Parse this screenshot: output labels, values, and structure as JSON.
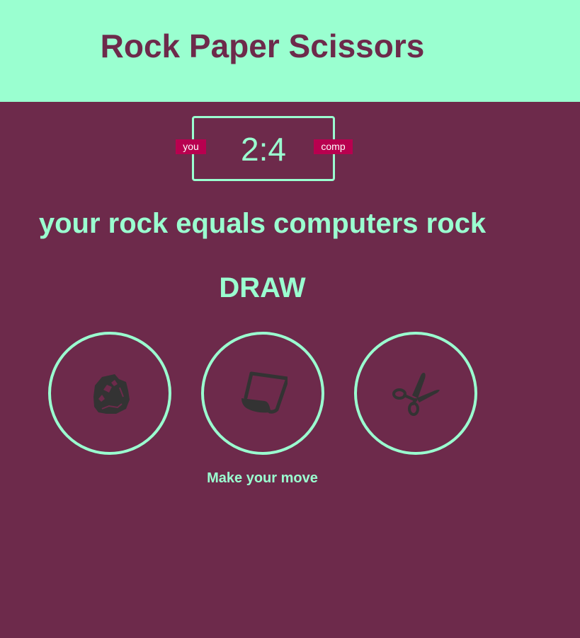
{
  "header": {
    "title": "Rock Paper Scissors"
  },
  "scoreboard": {
    "user_label": "you",
    "comp_label": "comp",
    "user_score": 2,
    "comp_score": 4,
    "score_text": "2:4"
  },
  "result": {
    "message": "your rock equals computers rock",
    "outcome": "DRAW"
  },
  "choices": [
    {
      "id": "rock",
      "icon": "rock-icon"
    },
    {
      "id": "paper",
      "icon": "paper-icon"
    },
    {
      "id": "scissors",
      "icon": "scissors-icon"
    }
  ],
  "action": {
    "message": "Make your move"
  },
  "colors": {
    "background": "#6d2a4b",
    "header": "#9affd0",
    "accent": "#9affd0",
    "badge": "#b8004f",
    "icon": "#333333"
  }
}
